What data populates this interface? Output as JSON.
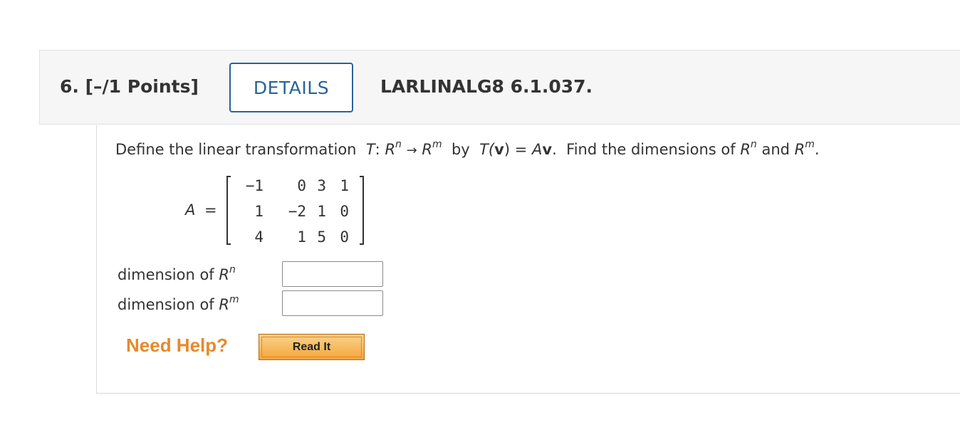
{
  "header": {
    "question_number": "6.",
    "points": "[–/1 Points]",
    "details_label": "DETAILS",
    "problem_code": "LARLINALG8 6.1.037."
  },
  "prompt": {
    "text_1": "Define the linear transformation",
    "T": "T",
    "colon": ":",
    "R": "R",
    "n": "n",
    "arrow": "→",
    "m": "m",
    "by": "by",
    "Tv_open": "T(",
    "v": "v",
    "Tv_close": ")",
    "eq": "=",
    "A": "A",
    "period": ".",
    "text_2": "Find the dimensions of",
    "and": "and",
    "end": "."
  },
  "matrix": {
    "label": "A",
    "equals": "=",
    "rows": [
      [
        "−1",
        "0",
        "3",
        "1"
      ],
      [
        "1",
        "−2",
        "1",
        "0"
      ],
      [
        "4",
        "1",
        "5",
        "0"
      ]
    ]
  },
  "answers": {
    "dim_label": "dimension of",
    "R": "R",
    "n": "n",
    "m": "m",
    "value_n": "",
    "value_m": ""
  },
  "help": {
    "need_help": "Need Help?",
    "read_it": "Read It"
  }
}
